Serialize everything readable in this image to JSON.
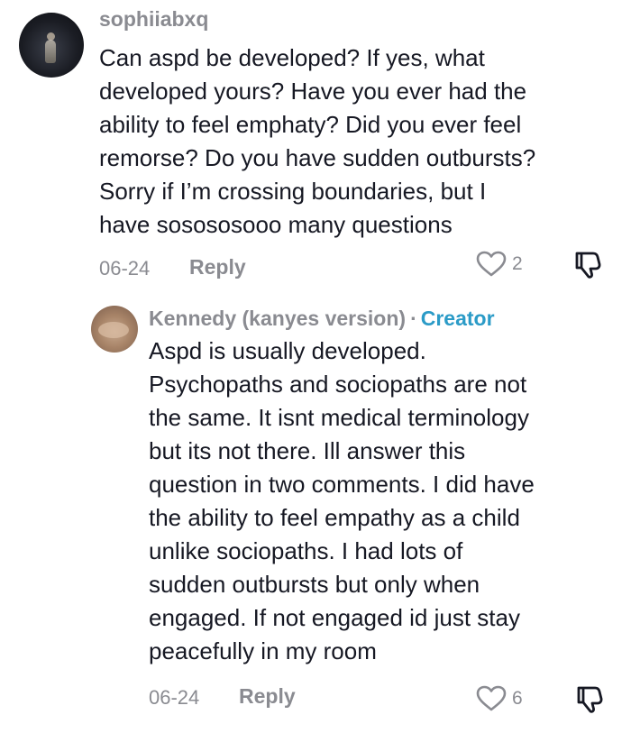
{
  "comments": [
    {
      "username": "sophiiabxq",
      "text_lines": [
        "Can aspd be developed? If yes, what",
        "developed yours? Have you ever had the",
        "ability to feel emphaty? Did you ever feel",
        "remorse? Do you have sudden outbursts?",
        "Sorry if I’m crossing boundaries, but I",
        "have sosososooo many questions"
      ],
      "date": "06-24",
      "reply_label": "Reply",
      "likes": "2"
    }
  ],
  "reply": {
    "username": "Kennedy (kanyes version)",
    "separator": "·",
    "badge": "Creator",
    "text_lines": [
      "Aspd is usually developed.",
      "Psychopaths and sociopaths are not",
      "the same. It isnt medical terminology",
      "but its not there. Ill answer this",
      "question in two comments. I did have",
      "the ability to feel empathy as a child",
      "unlike sociopaths. I had lots of",
      "sudden outbursts but only when",
      "engaged. If not engaged id just stay",
      "peacefully in my room"
    ],
    "date": "06-24",
    "reply_label": "Reply",
    "likes": "6"
  },
  "icons": {
    "like": "heart-outline-icon",
    "dislike": "thumbs-down-icon"
  },
  "colors": {
    "username": "#8a8b91",
    "creator_badge": "#2b9bc7",
    "text": "#161823",
    "meta": "#8a8b91"
  }
}
